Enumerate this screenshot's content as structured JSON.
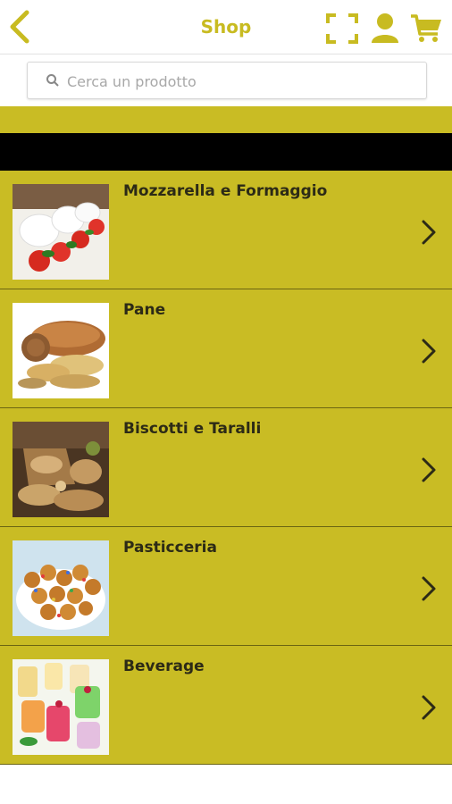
{
  "header": {
    "title": "Shop",
    "icons": [
      "back-arrow-icon",
      "scan-icon",
      "user-icon",
      "cart-icon"
    ],
    "accent_color": "#c8bb21"
  },
  "search": {
    "placeholder": "Cerca un prodotto"
  },
  "categories": [
    {
      "label": "Mozzarella e Formaggio",
      "image": "mozzarella-tomato-photo"
    },
    {
      "label": "Pane",
      "image": "bread-photo"
    },
    {
      "label": "Biscotti e Taralli",
      "image": "biscuits-photo"
    },
    {
      "label": "Pasticceria",
      "image": "pastry-photo"
    },
    {
      "label": "Beverage",
      "image": "drinks-photo"
    }
  ],
  "colors": {
    "list_bg": "#c9bc24",
    "banner": "#000000",
    "text": "#2c2a16"
  }
}
